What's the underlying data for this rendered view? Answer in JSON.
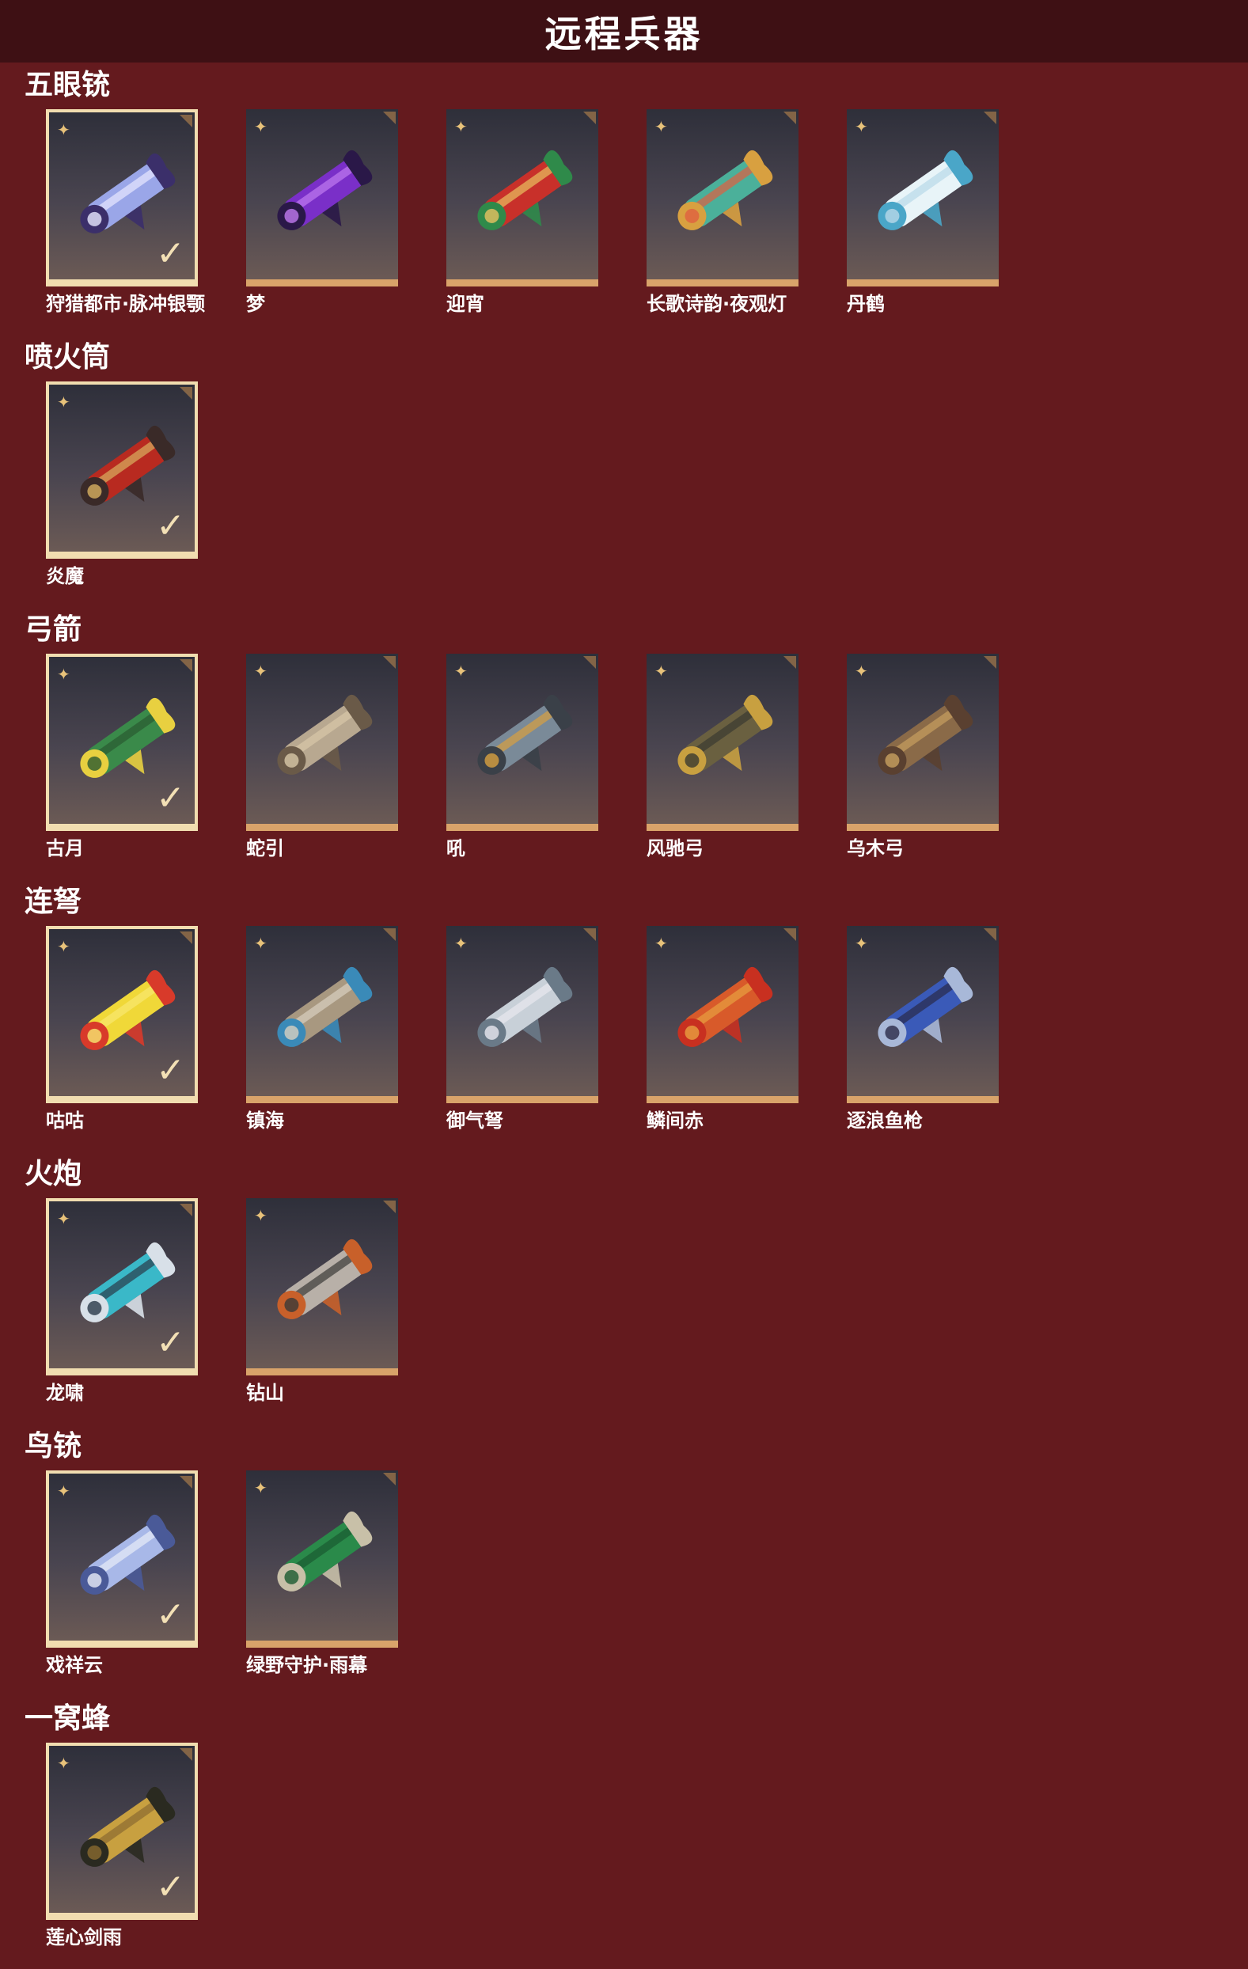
{
  "header": {
    "title": "远程兵器"
  },
  "sections": [
    {
      "title": "五眼铳",
      "items": [
        {
          "name": "狩猎都市·脉冲银颚",
          "owned": true,
          "icon": "blunderbuss-weapon-icon",
          "colors": [
            "#9aa6e8",
            "#3b2f6a",
            "#e8e8ff"
          ]
        },
        {
          "name": "梦",
          "owned": false,
          "icon": "blunderbuss-weapon-icon",
          "colors": [
            "#7a2fc8",
            "#2a1848",
            "#c07af0"
          ]
        },
        {
          "name": "迎宵",
          "owned": false,
          "icon": "blunderbuss-weapon-icon",
          "colors": [
            "#c8302a",
            "#2f8a4a",
            "#e8c060"
          ]
        },
        {
          "name": "长歌诗韵·夜观灯",
          "owned": false,
          "icon": "blunderbuss-weapon-icon",
          "colors": [
            "#4bb09a",
            "#d8a040",
            "#e06040"
          ]
        },
        {
          "name": "丹鹤",
          "owned": false,
          "icon": "blunderbuss-weapon-icon",
          "colors": [
            "#e8f4f8",
            "#4aa6c8",
            "#b8d8e8"
          ]
        }
      ]
    },
    {
      "title": "喷火筒",
      "items": [
        {
          "name": "炎魔",
          "owned": true,
          "icon": "flamethrower-weapon-icon",
          "colors": [
            "#b82a20",
            "#3a2a28",
            "#d8b060"
          ]
        }
      ]
    },
    {
      "title": "弓箭",
      "items": [
        {
          "name": "古月",
          "owned": true,
          "icon": "bow-weapon-icon",
          "colors": [
            "#3a8a4a",
            "#e8d040",
            "#2a5a30"
          ]
        },
        {
          "name": "蛇引",
          "owned": false,
          "icon": "bow-weapon-icon",
          "colors": [
            "#b8a890",
            "#6a5a48",
            "#d8c8a8"
          ]
        },
        {
          "name": "吼",
          "owned": false,
          "icon": "bow-weapon-icon",
          "colors": [
            "#7a8a98",
            "#3a4048",
            "#d8a040"
          ]
        },
        {
          "name": "风驰弓",
          "owned": false,
          "icon": "bow-weapon-icon",
          "colors": [
            "#6a6040",
            "#c8a040",
            "#3a3a30"
          ]
        },
        {
          "name": "乌木弓",
          "owned": false,
          "icon": "bow-weapon-icon",
          "colors": [
            "#8a6a48",
            "#5a4030",
            "#c8a060"
          ]
        }
      ]
    },
    {
      "title": "连弩",
      "items": [
        {
          "name": "咕咕",
          "owned": true,
          "icon": "crossbow-weapon-icon",
          "colors": [
            "#f0d838",
            "#d83a2a",
            "#f8e870"
          ]
        },
        {
          "name": "镇海",
          "owned": false,
          "icon": "crossbow-weapon-icon",
          "colors": [
            "#a89880",
            "#3a8ab8",
            "#d8d0c0"
          ]
        },
        {
          "name": "御气弩",
          "owned": false,
          "icon": "crossbow-weapon-icon",
          "colors": [
            "#c8d0d8",
            "#6a7a88",
            "#e8e8f0"
          ]
        },
        {
          "name": "鳞间赤",
          "owned": false,
          "icon": "crossbow-weapon-icon",
          "colors": [
            "#d85a2a",
            "#c83020",
            "#e8a040"
          ]
        },
        {
          "name": "逐浪鱼枪",
          "owned": false,
          "icon": "crossbow-weapon-icon",
          "colors": [
            "#3a5ab8",
            "#a8b8d8",
            "#2a2a48"
          ]
        }
      ]
    },
    {
      "title": "火炮",
      "items": [
        {
          "name": "龙啸",
          "owned": true,
          "icon": "cannon-weapon-icon",
          "colors": [
            "#3ab8c8",
            "#d8e0e8",
            "#2a3a48"
          ]
        },
        {
          "name": "钻山",
          "owned": false,
          "icon": "cannon-weapon-icon",
          "colors": [
            "#b8b0a8",
            "#c8602a",
            "#3a3a38"
          ]
        }
      ]
    },
    {
      "title": "鸟铳",
      "items": [
        {
          "name": "戏祥云",
          "owned": true,
          "icon": "musket-weapon-icon",
          "colors": [
            "#a8b8e8",
            "#4a5a98",
            "#e8ecf8"
          ]
        },
        {
          "name": "绿野守护·雨幕",
          "owned": false,
          "icon": "musket-weapon-icon",
          "colors": [
            "#2a8a4a",
            "#c8c0a8",
            "#1a5a30"
          ]
        }
      ]
    },
    {
      "title": "一窝蜂",
      "items": [
        {
          "name": "莲心剑雨",
          "owned": true,
          "icon": "rocket-launcher-weapon-icon",
          "colors": [
            "#c8a040",
            "#2a2a20",
            "#8a6a30"
          ]
        }
      ]
    }
  ],
  "icons": {
    "rarity": "sparkle-icon",
    "owned": "checkmark-icon",
    "corner": "corner-tag-icon"
  },
  "colors": {
    "background": "#641a1e",
    "title_bar": "#3e1014",
    "card_border_owned": "#f1ddb0",
    "card_bottom": "#d9a36a"
  }
}
